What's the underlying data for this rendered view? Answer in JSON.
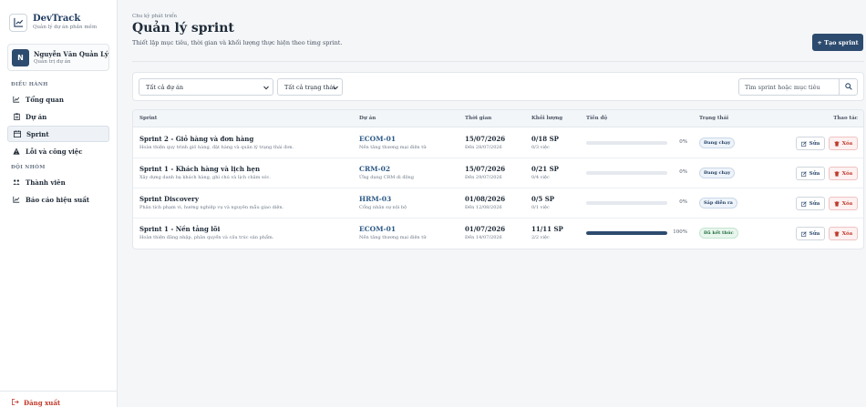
{
  "brand": {
    "title": "DevTrack",
    "subtitle": "Quản lý dự án phần mềm",
    "icon": "chart-line-icon"
  },
  "user": {
    "initial": "N",
    "name": "Nguyễn Văn Quản Lý",
    "role": "Quản trị dự án"
  },
  "nav": {
    "section_operate": "ĐIỀU HÀNH",
    "section_team": "ĐỘI NHÓM",
    "items": [
      {
        "label": "Tổng quan",
        "icon": "chart-line-icon"
      },
      {
        "label": "Dự án",
        "icon": "clipboard-icon"
      },
      {
        "label": "Sprint",
        "icon": "calendar-icon",
        "active": true
      },
      {
        "label": "Lỗi và công việc",
        "icon": "warning-icon"
      },
      {
        "label": "Thành viên",
        "icon": "users-icon"
      },
      {
        "label": "Báo cáo hiệu suất",
        "icon": "chart-line-icon"
      }
    ],
    "logout": "Đăng xuất"
  },
  "header": {
    "eyebrow": "Chu kỳ phát triển",
    "title": "Quản lý sprint",
    "subtitle": "Thiết lập mục tiêu, thời gian và khối lượng thực hiện theo từng sprint.",
    "create_label": "+ Tạo sprint"
  },
  "filters": {
    "project_select": "Tất cả dự án",
    "status_select": "Tất cả trạng thái",
    "search_placeholder": "Tìm sprint hoặc mục tiêu"
  },
  "table": {
    "headers": {
      "sprint": "Sprint",
      "project": "Dự án",
      "time": "Thời gian",
      "workload": "Khối lượng",
      "progress": "Tiến độ",
      "status": "Trạng thái",
      "actions": "Thao tác"
    },
    "edit_label": "Sửa",
    "delete_label": "Xóa",
    "rows": [
      {
        "name": "Sprint 2 - Giỏ hàng và đơn hàng",
        "desc": "Hoàn thiện quy trình giỏ hàng, đặt hàng và quản lý trạng thái đơn.",
        "project_code": "ECOM-01",
        "project_name": "Nền tảng thương mại điện tử",
        "start": "15/07/2026",
        "end": "Đến 28/07/2026",
        "sp": "0/18 SP",
        "tasks": "0/3 việc",
        "progress": 0,
        "progress_label": "0%",
        "status": "Đang chạy",
        "status_kind": "running"
      },
      {
        "name": "Sprint 1 - Khách hàng và lịch hẹn",
        "desc": "Xây dựng danh bạ khách hàng, ghi chú và lịch chăm sóc.",
        "project_code": "CRM-02",
        "project_name": "Ứng dụng CRM di động",
        "start": "15/07/2026",
        "end": "Đến 29/07/2026",
        "sp": "0/21 SP",
        "tasks": "0/4 việc",
        "progress": 0,
        "progress_label": "0%",
        "status": "Đang chạy",
        "status_kind": "running"
      },
      {
        "name": "Sprint Discovery",
        "desc": "Phân tích phạm vi, hướng nghiệp vụ và nguyên mẫu giao diện.",
        "project_code": "HRM-03",
        "project_name": "Cổng nhân sự nội bộ",
        "start": "01/08/2026",
        "end": "Đến 12/08/2026",
        "sp": "0/5 SP",
        "tasks": "0/1 việc",
        "progress": 0,
        "progress_label": "0%",
        "status": "Sắp diễn ra",
        "status_kind": "upcoming"
      },
      {
        "name": "Sprint 1 - Nền tảng lõi",
        "desc": "Hoàn thiện đăng nhập, phân quyền và cấu trúc sản phẩm.",
        "project_code": "ECOM-01",
        "project_name": "Nền tảng thương mại điện tử",
        "start": "01/07/2026",
        "end": "Đến 14/07/2026",
        "sp": "11/11 SP",
        "tasks": "2/2 việc",
        "progress": 100,
        "progress_label": "100%",
        "status": "Đã kết thúc",
        "status_kind": "done"
      }
    ]
  },
  "colors": {
    "primary": "#2d4b6e",
    "danger": "#c0392b",
    "success": "#1c6b3a"
  }
}
